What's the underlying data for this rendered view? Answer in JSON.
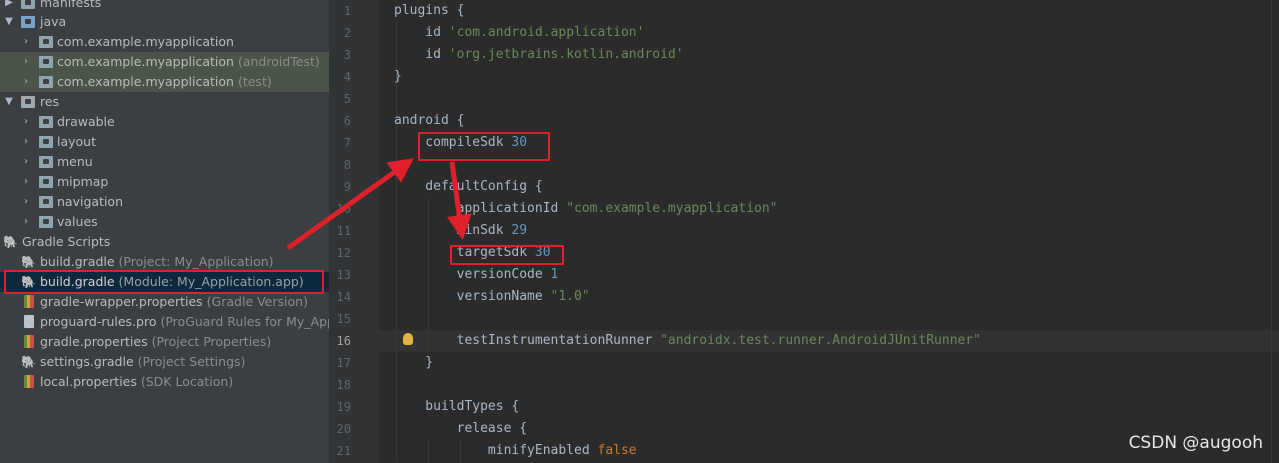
{
  "tree": {
    "items": [
      {
        "name": "manifests",
        "hint": ""
      },
      {
        "name": "java",
        "hint": ""
      },
      {
        "name": "com.example.myapplication",
        "hint": ""
      },
      {
        "name": "com.example.myapplication",
        "hint": "(androidTest)"
      },
      {
        "name": "com.example.myapplication",
        "hint": "(test)"
      },
      {
        "name": "res",
        "hint": ""
      },
      {
        "name": "drawable",
        "hint": ""
      },
      {
        "name": "layout",
        "hint": ""
      },
      {
        "name": "menu",
        "hint": ""
      },
      {
        "name": "mipmap",
        "hint": ""
      },
      {
        "name": "navigation",
        "hint": ""
      },
      {
        "name": "values",
        "hint": ""
      },
      {
        "name": "Gradle Scripts",
        "hint": ""
      },
      {
        "name": "build.gradle",
        "hint": "(Project: My_Application)"
      },
      {
        "name": "build.gradle",
        "hint": "(Module: My_Application.app)"
      },
      {
        "name": "gradle-wrapper.properties",
        "hint": "(Gradle Version)"
      },
      {
        "name": "proguard-rules.pro",
        "hint": "(ProGuard Rules for My_Appli"
      },
      {
        "name": "gradle.properties",
        "hint": "(Project Properties)"
      },
      {
        "name": "settings.gradle",
        "hint": "(Project Settings)"
      },
      {
        "name": "local.properties",
        "hint": "(SDK Location)"
      }
    ]
  },
  "editor": {
    "current_line": "16",
    "lines": [
      {
        "n": "1",
        "tokens": [
          {
            "t": "plugins {",
            "c": "kw"
          }
        ]
      },
      {
        "n": "2",
        "tokens": [
          {
            "t": "    id ",
            "c": "kw"
          },
          {
            "t": "'com.android.application'",
            "c": "str"
          }
        ]
      },
      {
        "n": "3",
        "tokens": [
          {
            "t": "    id ",
            "c": "kw"
          },
          {
            "t": "'org.jetbrains.kotlin.android'",
            "c": "str"
          }
        ]
      },
      {
        "n": "4",
        "tokens": [
          {
            "t": "}",
            "c": "kw"
          }
        ]
      },
      {
        "n": "5",
        "tokens": []
      },
      {
        "n": "6",
        "tokens": [
          {
            "t": "android {",
            "c": "kw"
          }
        ]
      },
      {
        "n": "7",
        "tokens": [
          {
            "t": "    compileSdk ",
            "c": "kw"
          },
          {
            "t": "30",
            "c": "num"
          }
        ]
      },
      {
        "n": "8",
        "tokens": []
      },
      {
        "n": "9",
        "tokens": [
          {
            "t": "    defaultConfig {",
            "c": "kw"
          }
        ]
      },
      {
        "n": "10",
        "tokens": [
          {
            "t": "        applicationId ",
            "c": "kw"
          },
          {
            "t": "\"com.example.myapplication\"",
            "c": "str"
          }
        ]
      },
      {
        "n": "11",
        "tokens": [
          {
            "t": "        minSdk ",
            "c": "kw"
          },
          {
            "t": "29",
            "c": "num"
          }
        ]
      },
      {
        "n": "12",
        "tokens": [
          {
            "t": "        targetSdk ",
            "c": "kw"
          },
          {
            "t": "30",
            "c": "num"
          }
        ]
      },
      {
        "n": "13",
        "tokens": [
          {
            "t": "        versionCode ",
            "c": "kw"
          },
          {
            "t": "1",
            "c": "num"
          }
        ]
      },
      {
        "n": "14",
        "tokens": [
          {
            "t": "        versionName ",
            "c": "kw"
          },
          {
            "t": "\"1.0\"",
            "c": "str"
          }
        ]
      },
      {
        "n": "15",
        "tokens": []
      },
      {
        "n": "16",
        "tokens": [
          {
            "t": "        testInstrumentationRunner ",
            "c": "kw"
          },
          {
            "t": "\"androidx.test.runner.AndroidJUnitRunner\"",
            "c": "str"
          }
        ]
      },
      {
        "n": "17",
        "tokens": [
          {
            "t": "    }",
            "c": "kw"
          }
        ]
      },
      {
        "n": "18",
        "tokens": []
      },
      {
        "n": "19",
        "tokens": [
          {
            "t": "    buildTypes {",
            "c": "kw"
          }
        ]
      },
      {
        "n": "20",
        "tokens": [
          {
            "t": "        release {",
            "c": "kw"
          }
        ]
      },
      {
        "n": "21",
        "tokens": [
          {
            "t": "            minifyEnabled ",
            "c": "kw"
          },
          {
            "t": "false",
            "c": "bool"
          }
        ]
      }
    ]
  },
  "watermark": "CSDN @augooh",
  "colors": {
    "annotation": "#e0202a",
    "selection": "#0d293e",
    "tree_bg": "#3c3f41",
    "editor_bg": "#2b2b2b"
  }
}
